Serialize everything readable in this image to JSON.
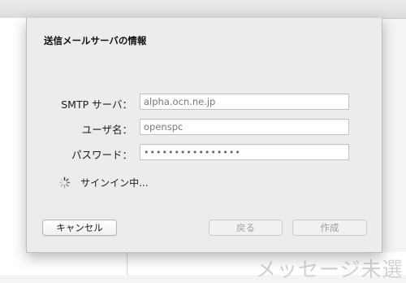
{
  "dialog": {
    "title": "送信メールサーバの情報"
  },
  "fields": {
    "smtp_server": {
      "label": "SMTP サーバ：",
      "value": "alpha.ocn.ne.jp"
    },
    "username": {
      "label": "ユーザ名：",
      "value": "openspc"
    },
    "password": {
      "label": "パスワード：",
      "value": "••••••••••••••••"
    }
  },
  "status": {
    "icon": "spinner-icon",
    "text": "サインイン中..."
  },
  "buttons": {
    "cancel": "キャンセル",
    "back": "戻る",
    "create": "作成"
  },
  "background": {
    "watermark": "メッセージ未選"
  }
}
